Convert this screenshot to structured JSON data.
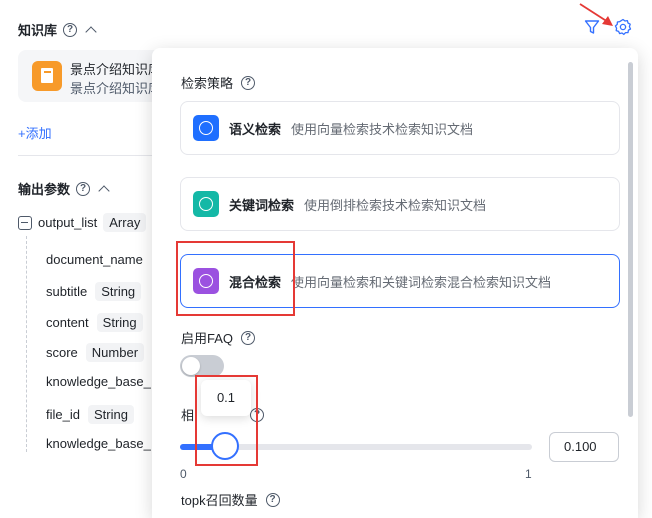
{
  "knowledge": {
    "title": "知识库",
    "card_title": "景点介绍知识库",
    "card_subtitle": "景点介绍知识库",
    "add_label": "+添加"
  },
  "output": {
    "title": "输出参数",
    "list_name": "output_list",
    "list_type": "Array",
    "fields": [
      {
        "name": "document_name",
        "type": ""
      },
      {
        "name": "subtitle",
        "type": "String"
      },
      {
        "name": "content",
        "type": "String"
      },
      {
        "name": "score",
        "type": "Number"
      },
      {
        "name": "knowledge_base_",
        "type": ""
      },
      {
        "name": "file_id",
        "type": "String"
      },
      {
        "name": "knowledge_base_",
        "type": ""
      }
    ]
  },
  "popover": {
    "strategy_label": "检索策略",
    "modes": [
      {
        "name": "语义检索",
        "desc": "使用向量检索技术检索知识文档",
        "color": "#1f6fff",
        "selected": false
      },
      {
        "name": "关键词检索",
        "desc": "使用倒排检索技术检索知识文档",
        "color": "#14b8a6",
        "selected": false
      },
      {
        "name": "混合检索",
        "desc": "使用向量检索和关键词检索混合检索知识文档",
        "color": "#9b51e0",
        "selected": true
      }
    ],
    "faq_label": "启用FAQ",
    "faq_enabled": false,
    "similarity_label": "相",
    "slider": {
      "value": 0.1,
      "min_label": "0",
      "max_label": "1",
      "tooltip": "0.1",
      "input_value": "0.100"
    },
    "topk_label": "topk召回数量"
  },
  "icons": {
    "filter": "funnel-icon",
    "settings": "gear-icon",
    "annotation_color": "#e53935"
  }
}
